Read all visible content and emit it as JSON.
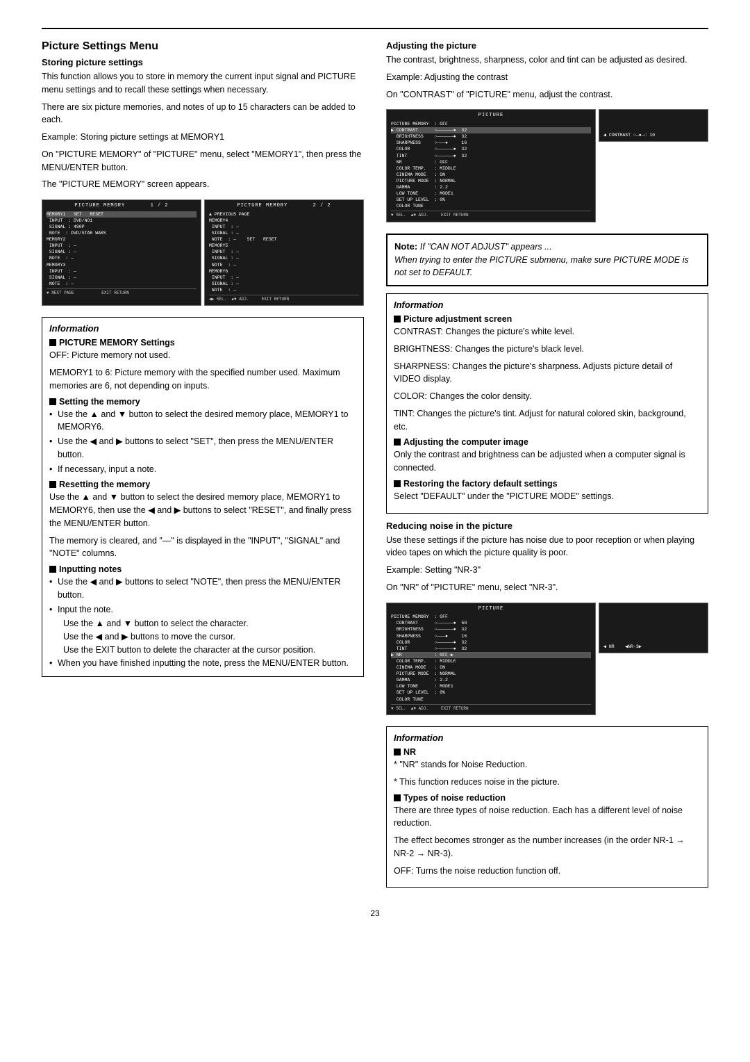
{
  "page": {
    "page_number": "23",
    "top_border": true
  },
  "left_column": {
    "main_title": "Picture Settings Menu",
    "storing_section": {
      "title": "Storing picture settings",
      "para1": "This function allows you to store in memory the current input signal and PICTURE menu settings and to recall these settings when necessary.",
      "para2": "There are six picture memories, and notes of up to 15 characters can be added to each.",
      "example": "Example: Storing picture settings at MEMORY1",
      "instruction1": "On \"PICTURE MEMORY\" of \"PICTURE\" menu, select \"MEMORY1\", then press the MENU/ENTER button.",
      "instruction2": "The \"PICTURE MEMORY\" screen appears."
    },
    "info_box": {
      "title": "Information",
      "sections": [
        {
          "heading": "■ PICTURE MEMORY Settings",
          "items": [
            "OFF: Picture memory not used.",
            "MEMORY1 to 6: Picture memory with the specified number used. Maximum memories are 6, not depending on inputs."
          ]
        },
        {
          "heading": "■ Setting the memory",
          "bullets": [
            "Use the ▲ and ▼ button to select the desired memory place, MEMORY1 to MEMORY6.",
            "Use the ◀ and ▶ buttons to select \"SET\", then press the MENU/ENTER button.",
            "If necessary, input a note."
          ]
        },
        {
          "heading": "■ Resetting the memory",
          "para": "Use the ▲ and ▼ button to select the desired memory place, MEMORY1 to MEMORY6, then use the ◀ and ▶ buttons to select \"RESET\", and finally press the MENU/ENTER button.",
          "para2": "The memory is cleared, and \"—\" is displayed in the \"INPUT\", \"SIGNAL\" and \"NOTE\" columns."
        },
        {
          "heading": "■ Inputting notes",
          "bullets": [
            "Use the ◀ and ▶ buttons to select \"NOTE\", then press the MENU/ENTER button.",
            "Input the note.",
            "Use the ▲ and ▼ button to select the character.",
            "Use the ◀ and ▶ buttons to move the cursor.",
            "Use the EXIT button to delete the character at the cursor position.",
            "When you have finished inputting the note, press the MENU/ENTER button."
          ]
        }
      ]
    }
  },
  "right_column": {
    "adjusting_section": {
      "title": "Adjusting the picture",
      "para1": "The contrast, brightness, sharpness, color and tint can be adjusted as desired.",
      "example": "Example: Adjusting the contrast",
      "instruction": "On \"CONTRAST\" of \"PICTURE\" menu, adjust the contrast."
    },
    "note_box": {
      "title": "Note:",
      "text1": "If \"CAN NOT ADJUST\" appears ...",
      "text2": "When trying to enter the PICTURE submenu, make sure PICTURE MODE is not set to DEFAULT."
    },
    "info_box2": {
      "title": "Information",
      "sections": [
        {
          "heading": "■ Picture adjustment screen",
          "items": [
            "CONTRAST: Changes the picture's white level.",
            "BRIGHTNESS: Changes the picture's black level.",
            "SHARPNESS: Changes the picture's sharpness. Adjusts picture detail of VIDEO display.",
            "COLOR: Changes the color density.",
            "TINT: Changes the picture's tint. Adjust for natural colored skin, background, etc."
          ]
        },
        {
          "heading": "■ Adjusting the computer image",
          "para": "Only the contrast and brightness can be adjusted when a computer signal is connected."
        },
        {
          "heading": "■ Restoring the factory default settings",
          "para": "Select \"DEFAULT\" under the \"PICTURE MODE\" settings."
        }
      ]
    },
    "reducing_section": {
      "title": "Reducing noise in the picture",
      "para1": "Use these settings if the picture has noise due to poor reception or when playing video tapes on which the picture quality is poor.",
      "example": "Example: Setting \"NR-3\"",
      "instruction": "On \"NR\" of \"PICTURE\" menu, select \"NR-3\"."
    },
    "info_box3": {
      "title": "Information",
      "sections": [
        {
          "heading": "■ NR",
          "items": [
            "* \"NR\" stands for Noise Reduction.",
            "* This function reduces noise in the picture."
          ]
        },
        {
          "heading": "■ Types of noise reduction",
          "para": "There are three types of noise reduction. Each has a different level of noise reduction.",
          "para2": "The effect becomes stronger as the number increases (in the order NR-1 → NR-2 → NR-3).",
          "para3": "OFF: Turns the noise reduction function off."
        }
      ]
    }
  },
  "screens": {
    "picture_memory_1": {
      "title": "PICTURE MEMORY",
      "page": "1 / 2",
      "rows": [
        "MEMORY1   SET   RESET",
        " INPUT : DVD/NO1",
        " SIGNAL : 480P",
        " NOTE : DVD/STAR WARS",
        "MEMORY2",
        " INPUT : —",
        " SIGNAL : —",
        " NOTE : —",
        "MEMORY3",
        " INPUT : —",
        " SIGNAL : —",
        " NOTE : —"
      ],
      "nav": "▼ NEXT PAGE          EXIT RETURN"
    },
    "picture_memory_2": {
      "title": "PICTURE MEMORY",
      "page": "2 / 2",
      "rows": [
        "▲ PREVIOUS PAGE",
        "MEMORY4",
        " INPUT : —",
        " SIGNAL : —",
        " NOTE : —   SET   RESET",
        "MEMORY5",
        " INPUT : —",
        " SIGNAL : —",
        " NOTE : —",
        "MEMORY6",
        " INPUT : —",
        " SIGNAL : —",
        " NOTE : —"
      ],
      "nav": "◀▶ SEL.  ▲▼ ADJ.    EXIT RETURN"
    },
    "picture_contrast": {
      "title": "PICTURE",
      "rows": [
        "PICTURE MEMORY  : OFF",
        "▶ CONTRAST      ○———————●  32",
        "  BRIGHTNESS    ○———————●  32",
        "  SHARPNESS     ○————●     16",
        "  COLOR         ○———————●  32",
        "  TINT          ○———————●  32",
        "  NR            : OFF",
        "  COLOR TEMP.   : MIDDLE",
        "  CINEMA MODE   : ON",
        "  PICTURE MODE  : NORMAL",
        "  GAMMA         : 2.2",
        "  LOW TONE      : MODE1",
        "  SET UP LEVEL  : 0%",
        "  COLOR TUNE"
      ],
      "side_indicator": "◀ CONTRAST  ○——●——○  10"
    },
    "picture_nr": {
      "title": "PICTURE",
      "rows": [
        "PICTURE MEMORY  : OFF",
        "  CONTRAST      ○———————●  50",
        "  BRIGHTNESS    ○———————●  32",
        "  SHARPNESS     ○————●     16",
        "  COLOR         ○———————●  32",
        "  TINT          ○———————●  32",
        "▶ NR            : OFF ▶",
        "  COLOR TEMP.   : MIDDLE",
        "  CINEMA MODE   : ON",
        "  PICTURE MODE  : NORMAL",
        "  GAMMA         : 2.2",
        "  LOW TONE      : MODE1",
        "  SET UP LEVEL  : 0%",
        "  COLOR TUNE"
      ],
      "side_indicator": "◀ NR        ◀ NR-3 ▶"
    }
  }
}
